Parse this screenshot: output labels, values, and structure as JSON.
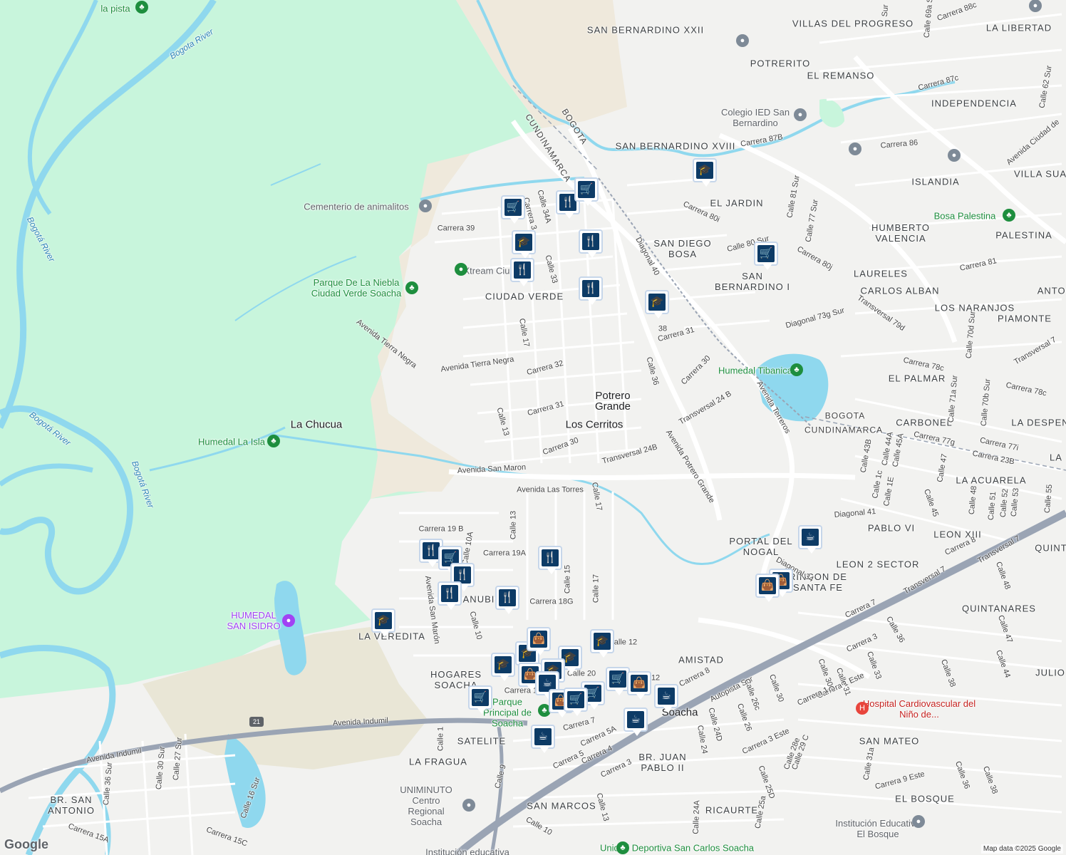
{
  "map": {
    "colors": {
      "park": "#c8f5dc",
      "water": "#8fd8ee",
      "land": "#f2f2f0",
      "sand": "#f0ece0",
      "road": "#ffffff",
      "highway": "#9aa4b4",
      "pin": "#0d3b66"
    },
    "neighborhoods": [
      "SAN BERNARDINO XXII",
      "VILLAS DEL PROGRESO",
      "LA LIBERTAD",
      "POTRERITO",
      "EL REMANSO",
      "INDEPENDENCIA",
      "SAN BERNARDINO XVIII",
      "ISLANDIA",
      "VILLA SUA",
      "EL JARDIN",
      "PALESTINA",
      "HUMBERTO VALENCIA",
      "SAN DIEGO BOSA",
      "SAN BERNARDINO I",
      "LAURELES",
      "CARLOS ALBAN",
      "ANTOI",
      "LOS NARANJOS",
      "PIAMONTE",
      "CIUDAD VERDE",
      "EL PALMAR",
      "CARBONEL",
      "LA DESPEN",
      "LA ACUARELA",
      "LA",
      "PABLO VI",
      "LEON XIII",
      "QUINT",
      "PORTAL DEL NOGAL",
      "LEON 2 SECTOR",
      "RINCON DE SANTA FE",
      "QUINTANARES",
      "AMISTAD",
      "JULIO",
      "LA VEREDITA",
      "HOGARES SOACHA",
      "SATELITE",
      "LA FRAGUA",
      "BR. SAN ANTONIO",
      "BR. JUAN PABLO II",
      "SAN MATEO",
      "SAN MARCOS",
      "RICAURTE",
      "EL BOSQUE",
      "ANUBI"
    ],
    "places": [
      "Potrero Grande",
      "Los Cerritos",
      "La Chucua",
      "Soacha"
    ],
    "admin": [
      "BOGOTA",
      "CUNDINAMARCA",
      "BOGOTA",
      "CUNDINAMARCA"
    ],
    "water": [
      "Bogota River",
      "Bogotá River",
      "Bogotá River",
      "Bogotá River"
    ],
    "parks": [
      "la pista",
      "Humedal La Isla",
      "Parque De La Niebla Ciudad Verde Soacha",
      "Humedal Tibanica",
      "Bosa Palestina",
      "Parque Principal de Soacha",
      "Unidad Deportiva San Carlos Soacha"
    ],
    "pois": [
      "Cementerio de animalitos",
      "Xtream Ciudad V",
      "Colegio IED San Bernardino",
      "UNIMINUTO Centro Regional Soacha",
      "Institución Educativa El Bosque",
      "Institución educativa"
    ],
    "poi_purple": [
      "HUMEDAL SAN ISIDRO"
    ],
    "poi_red": [
      "Hospital Cardiovascular del Niño de..."
    ],
    "streets": [
      "Carrera 39",
      "Calle 34A",
      "Calle 33",
      "Carrera 3",
      "Diagonal 40",
      "Calle 17",
      "Carrera 32",
      "Avenida Tierra Negra",
      "Avenida Tierra Negra",
      "Calle 13",
      "Carrera 31",
      "Carrera 30",
      "Avenida San Maron",
      "Avenida Las Torres",
      "Calle 17",
      "Transversal 24B",
      "Avenida Potrero Grande",
      "Carrera 30",
      "Transversal 24 B",
      "Calle 36",
      "Carrera 31",
      "38",
      "Avenida Terreros",
      "Carrera 19 B",
      "Carrera 19A",
      "Calle 13",
      "Calle 10A",
      "Avenida San Marón",
      "Calle 10",
      "Carrera 18G",
      "Calle 15",
      "Calle 17",
      "Calle 1",
      "Avenida Indumil",
      "Avenida Indumil",
      "Calle 36 Sur",
      "Calle 30 Sur",
      "Calle 27 Sur",
      "Calle 16 Sur",
      "Carrera 15A",
      "Carrera 15C",
      "Carrera 5",
      "Carrera 5A",
      "Carrera 4",
      "Carrera 3",
      "Carrera 7",
      "Calle 9",
      "Calle 10",
      "Calle 13",
      "Autopista Sur",
      "Carrera 8",
      "Calle 24D",
      "Calle 24",
      "Calle 26",
      "Calle 26c",
      "Calle 30",
      "Calle 25D",
      "Calle 24A",
      "Calle 25a",
      "Carrera 3 Este",
      "Calle 29 C",
      "Calle 28e",
      "Carrera 1 Este",
      "Calle 30C",
      "Calle 31",
      "Calle 33",
      "Carrera 1",
      "Carrera 3",
      "Calle 36",
      "Calle 38",
      "Calle 44",
      "Calle 47",
      "Calle 48",
      "Transversal 7",
      "Transversal 7",
      "Carrera 7",
      "Carrera 8",
      "Diagonal 34",
      "Diagonal 41",
      "Calle 43B",
      "Calle 44A",
      "Calle 45A",
      "Calle 1c",
      "Calle 1E",
      "Calle 45",
      "Calle 47",
      "Calle 48",
      "Calle 51",
      "Calle 52",
      "Calle 53",
      "Calle 55",
      "Carrera 23B",
      "Carrera 77g",
      "Carrera 77i",
      "Carrera 78c",
      "Carrera 78c",
      "Calle 71a Sur",
      "Calle 70b Sur",
      "Calle 70d Sur",
      "Transversal 79d",
      "Diagonal 73g Sur",
      "Carrera 81",
      "Carrera 80j",
      "Calle 80 Sur",
      "Calle 81 Sur",
      "Calle 77 Sur",
      "Carrera 80i",
      "Carrera 86",
      "Carrera 87B",
      "Carrera 87c",
      "Carrera 88c",
      "Calle 62 Sur",
      "Avenida Ciudad de",
      "Calle 69a Sur",
      "Sur",
      "Transversal 7",
      "Carrera 9 Este",
      "Calle 31a",
      "Calle 36",
      "Calle 38",
      "Calle 12",
      "Carrera 12",
      "Calle 20",
      "Calle 12"
    ],
    "route_shield": "21",
    "logo": "Google",
    "attribution": "Map data ©2025 Google",
    "pins": [
      {
        "icon": "cart"
      },
      {
        "icon": "food"
      },
      {
        "icon": "cart"
      },
      {
        "icon": "school"
      },
      {
        "icon": "food"
      },
      {
        "icon": "food"
      },
      {
        "icon": "food"
      },
      {
        "icon": "school"
      },
      {
        "icon": "school"
      },
      {
        "icon": "cart"
      },
      {
        "icon": "school"
      },
      {
        "icon": "food"
      },
      {
        "icon": "cart"
      },
      {
        "icon": "food"
      },
      {
        "icon": "food"
      },
      {
        "icon": "food"
      },
      {
        "icon": "food"
      },
      {
        "icon": "school"
      },
      {
        "icon": "coffee"
      },
      {
        "icon": "bag"
      },
      {
        "icon": "bag"
      },
      {
        "icon": "school"
      },
      {
        "icon": "school"
      },
      {
        "icon": "bag"
      },
      {
        "icon": "school"
      },
      {
        "icon": "school"
      },
      {
        "icon": "cart"
      },
      {
        "icon": "bag"
      },
      {
        "icon": "coffee"
      },
      {
        "icon": "cart"
      },
      {
        "icon": "bag"
      },
      {
        "icon": "bag"
      },
      {
        "icon": "cart"
      },
      {
        "icon": "coffee"
      },
      {
        "icon": "coffee"
      },
      {
        "icon": "coffee"
      },
      {
        "icon": "cart"
      }
    ],
    "icon_glyphs": {
      "cart": "🛒",
      "food": "🍴",
      "school": "🎓",
      "coffee": "☕",
      "bag": "👜",
      "park-icon": "♣",
      "poi-icon": "●"
    }
  }
}
